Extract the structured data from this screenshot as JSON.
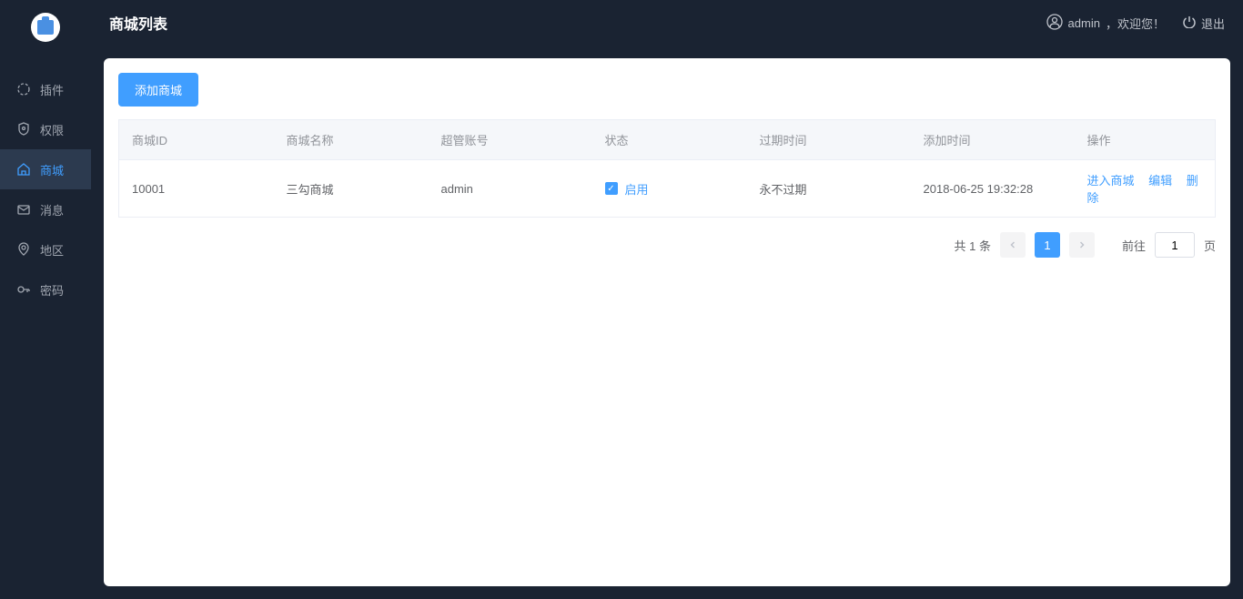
{
  "header": {
    "title": "商城列表",
    "user_prefix": "admin",
    "welcome": "，欢迎您！",
    "logout": "退出"
  },
  "sidebar": {
    "items": [
      {
        "label": "插件",
        "icon": "plugin"
      },
      {
        "label": "权限",
        "icon": "shield"
      },
      {
        "label": "商城",
        "icon": "home",
        "active": true
      },
      {
        "label": "消息",
        "icon": "mail"
      },
      {
        "label": "地区",
        "icon": "location"
      },
      {
        "label": "密码",
        "icon": "key"
      }
    ]
  },
  "toolbar": {
    "add_btn": "添加商城"
  },
  "table": {
    "headers": {
      "id": "商城ID",
      "name": "商城名称",
      "account": "超管账号",
      "status": "状态",
      "expire": "过期时间",
      "addtime": "添加时间",
      "action": "操作"
    },
    "rows": [
      {
        "id": "10001",
        "name": "三勾商城",
        "account": "admin",
        "status": "启用",
        "expire": "永不过期",
        "addtime": "2018-06-25 19:32:28"
      }
    ],
    "actions": {
      "enter": "进入商城",
      "edit": "编辑",
      "delete": "删除"
    }
  },
  "pagination": {
    "total": "共 1 条",
    "current": "1",
    "goto_prefix": "前往",
    "goto_suffix": "页",
    "page_input": "1"
  }
}
